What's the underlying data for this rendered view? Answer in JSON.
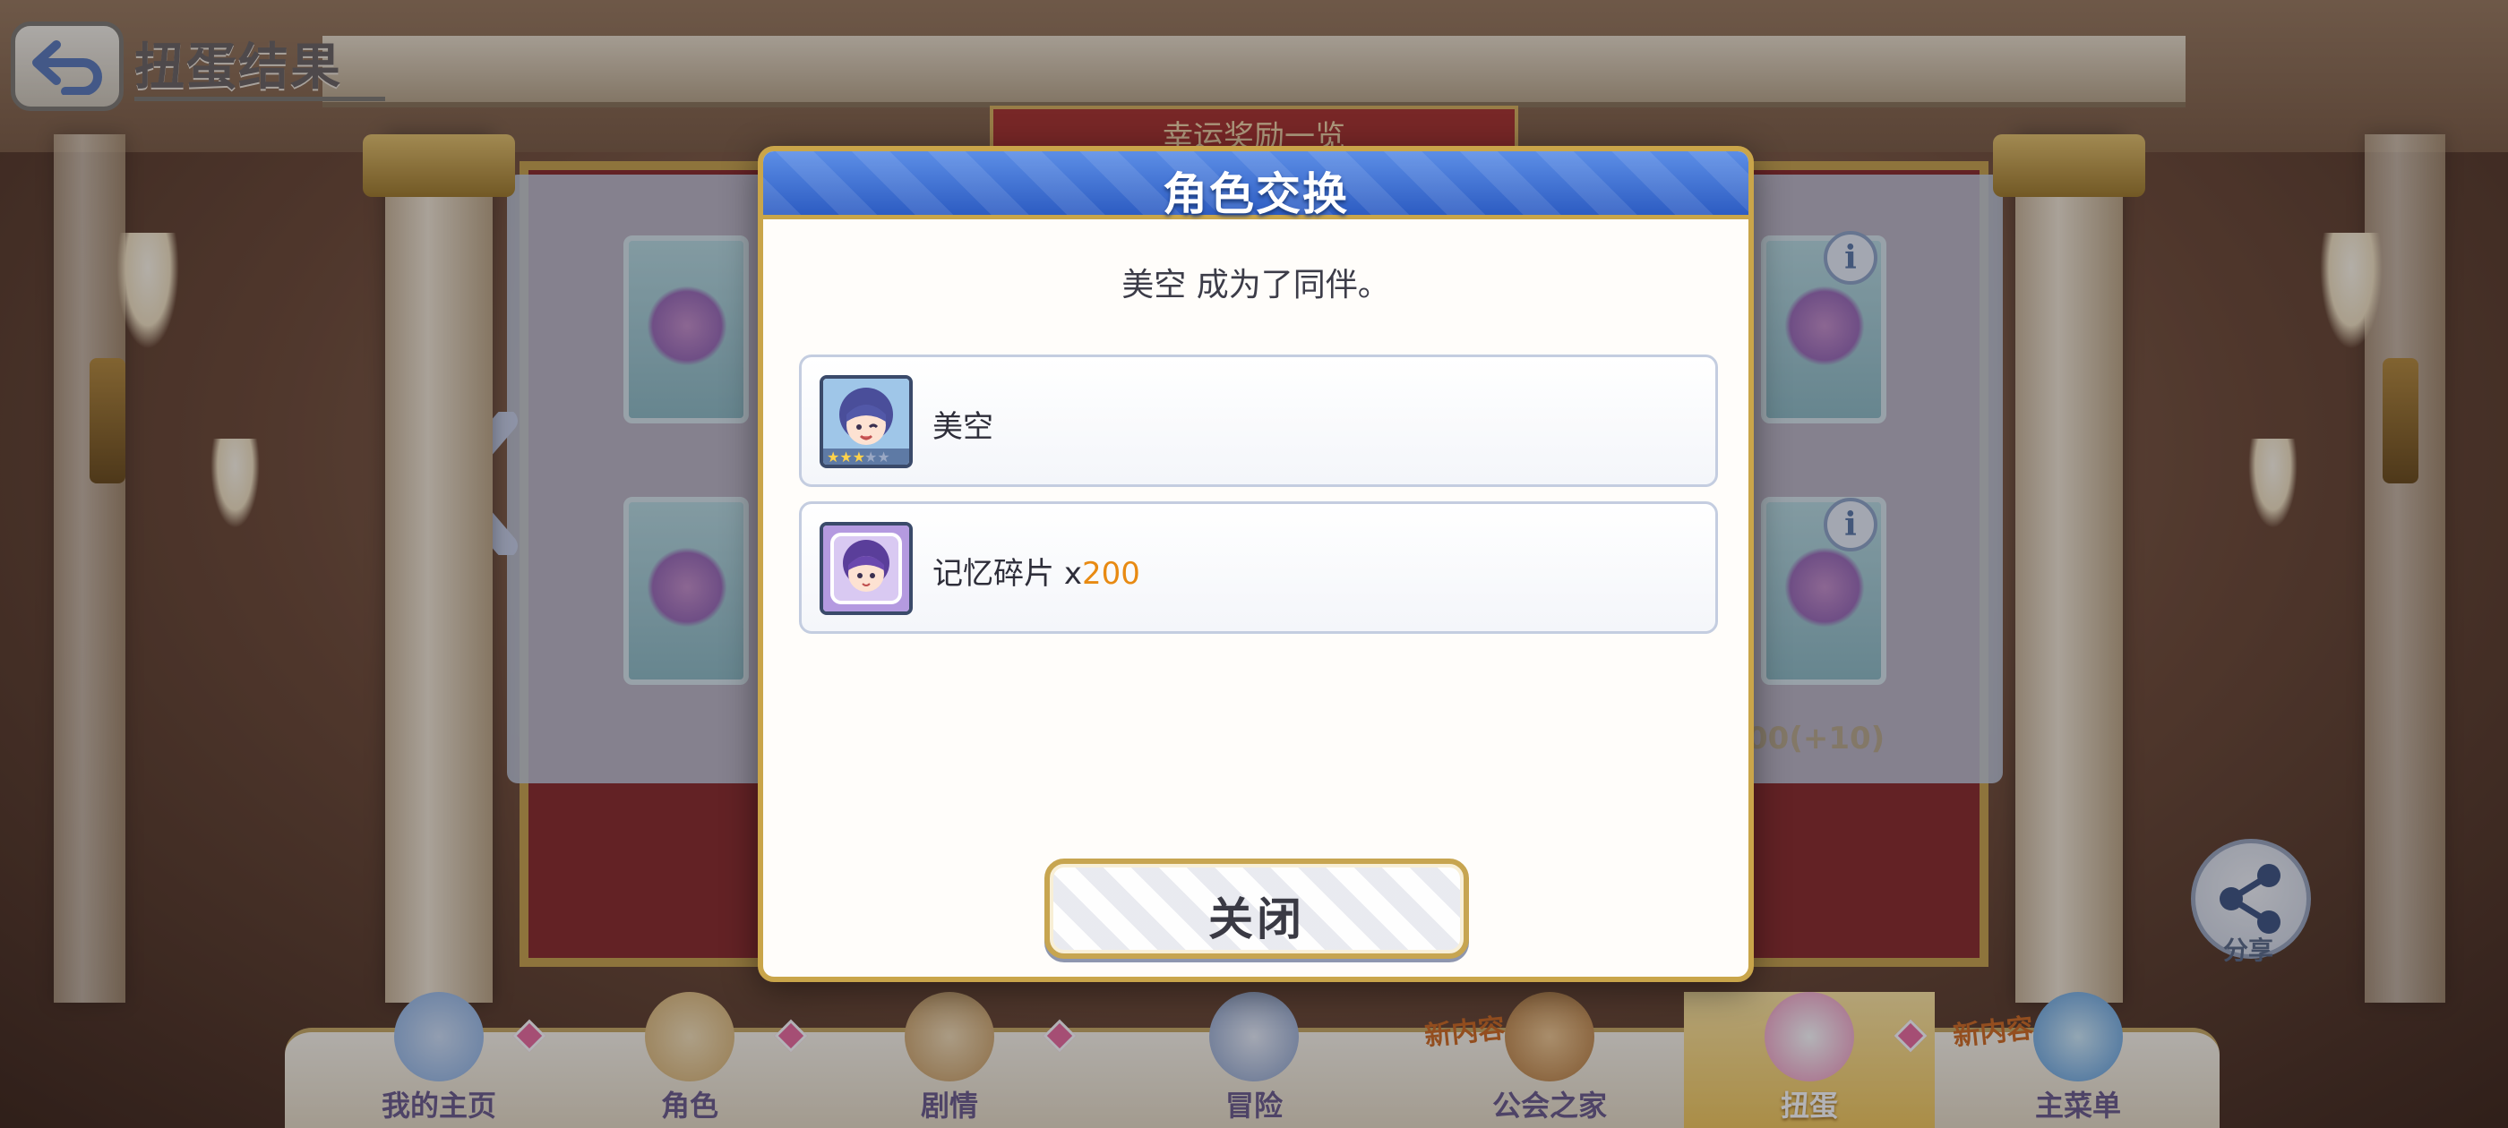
{
  "screen": {
    "title": "扭蛋结果",
    "bg_banner": "幸运奖励一览",
    "bg_count": "00(+10)"
  },
  "dialog": {
    "title": "角色交换",
    "message": "美空  成为了同伴。",
    "rewards": [
      {
        "name": "美空",
        "stars": 3,
        "icon": "character-portrait-icon"
      },
      {
        "name": "记忆碎片",
        "qty_prefix": "x",
        "qty": "200",
        "icon": "memory-piece-icon"
      }
    ],
    "close_label": "关闭"
  },
  "share": {
    "label": "分享"
  },
  "bottom_nav": {
    "items": [
      {
        "label": "我的主页",
        "badge": true
      },
      {
        "label": "角色",
        "badge": true
      },
      {
        "label": "剧情",
        "badge": true
      },
      {
        "label": "冒险",
        "new_tag": "新内容"
      },
      {
        "label": "公会之家"
      },
      {
        "label": "扭蛋",
        "active": true,
        "badge": true
      },
      {
        "label": "主菜单",
        "new_tag": "新内容"
      }
    ]
  },
  "colors": {
    "header_blue": "#2d5cc2",
    "gold_border": "#c9a54a",
    "qty_orange": "#e88a12",
    "nav_active": "#f2c85a"
  }
}
